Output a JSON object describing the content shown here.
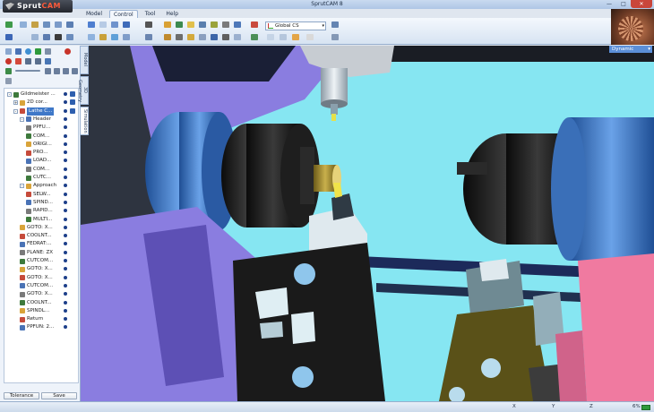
{
  "app": {
    "logo_text_a": "Sprut",
    "logo_text_b": "CAM",
    "window_title": "SprutCAM 8",
    "controls": {
      "minimize": "—",
      "maximize": "□",
      "close": "✕"
    }
  },
  "menu": {
    "tabs": [
      {
        "label": "Model"
      },
      {
        "label": "Control"
      },
      {
        "label": "Tool"
      },
      {
        "label": "Help"
      }
    ]
  },
  "ribbon": {
    "coordinate_system": "Global CS",
    "view_mode": "Dynamic"
  },
  "side_tabs": [
    {
      "label": "Model"
    },
    {
      "label": "3D Geometry"
    },
    {
      "label": "Simulation"
    }
  ],
  "tree": {
    "rows": [
      {
        "label": "Gildmeister ...",
        "indent": 0,
        "expander": "-",
        "selected": false
      },
      {
        "label": "2D cor...",
        "indent": 1,
        "expander": "+",
        "selected": false
      },
      {
        "label": "Lathe C...",
        "indent": 1,
        "expander": "-",
        "selected": true
      },
      {
        "label": "Header",
        "indent": 2,
        "expander": "-",
        "selected": false
      },
      {
        "label": "PPFU...",
        "indent": 3,
        "expander": "",
        "selected": false
      },
      {
        "label": "COM...",
        "indent": 3,
        "expander": "",
        "selected": false
      },
      {
        "label": "ORIGI...",
        "indent": 3,
        "expander": "",
        "selected": false
      },
      {
        "label": "PRO...",
        "indent": 3,
        "expander": "",
        "selected": false
      },
      {
        "label": "LOAD...",
        "indent": 3,
        "expander": "",
        "selected": false
      },
      {
        "label": "COM...",
        "indent": 3,
        "expander": "",
        "selected": false
      },
      {
        "label": "CUTC...",
        "indent": 3,
        "expander": "",
        "selected": false
      },
      {
        "label": "Approach",
        "indent": 2,
        "expander": "-",
        "selected": false
      },
      {
        "label": "SELW...",
        "indent": 3,
        "expander": "",
        "selected": false
      },
      {
        "label": "SPIND...",
        "indent": 3,
        "expander": "",
        "selected": false
      },
      {
        "label": "RAPID...",
        "indent": 3,
        "expander": "",
        "selected": false
      },
      {
        "label": "MULTI...",
        "indent": 3,
        "expander": "",
        "selected": false
      },
      {
        "label": "GOTO: X...",
        "indent": 2,
        "expander": "",
        "selected": false
      },
      {
        "label": "COOLNT...",
        "indent": 2,
        "expander": "",
        "selected": false
      },
      {
        "label": "FEDRAT:...",
        "indent": 2,
        "expander": "",
        "selected": false
      },
      {
        "label": "PLANE: ZX",
        "indent": 2,
        "expander": "",
        "selected": false
      },
      {
        "label": "CUTCOM...",
        "indent": 2,
        "expander": "",
        "selected": false
      },
      {
        "label": "GOTO: X...",
        "indent": 2,
        "expander": "",
        "selected": false
      },
      {
        "label": "GOTO: X...",
        "indent": 2,
        "expander": "",
        "selected": false
      },
      {
        "label": "CUTCOM...",
        "indent": 2,
        "expander": "",
        "selected": false
      },
      {
        "label": "GOTO: X...",
        "indent": 2,
        "expander": "",
        "selected": false
      },
      {
        "label": "COOLNT...",
        "indent": 2,
        "expander": "",
        "selected": false
      },
      {
        "label": "SPINDL...",
        "indent": 2,
        "expander": "",
        "selected": false
      },
      {
        "label": "Return",
        "indent": 2,
        "expander": "",
        "selected": false
      },
      {
        "label": "PPFUN: 2...",
        "indent": 2,
        "expander": "",
        "selected": false
      }
    ]
  },
  "buttons": {
    "tolerance": "Tolerance",
    "save": "Save"
  },
  "status": {
    "x_label": "X",
    "y_label": "Y",
    "z_label": "Z",
    "progress_label": "6%"
  },
  "colors": {
    "scene_background": "#86e6f2",
    "spindle_blue": "#4a7fc8",
    "housing_black": "#161616",
    "tool_block": "#dfe9ee",
    "pink_panel": "#f07aa0",
    "violet_panel": "#8a7de0"
  }
}
